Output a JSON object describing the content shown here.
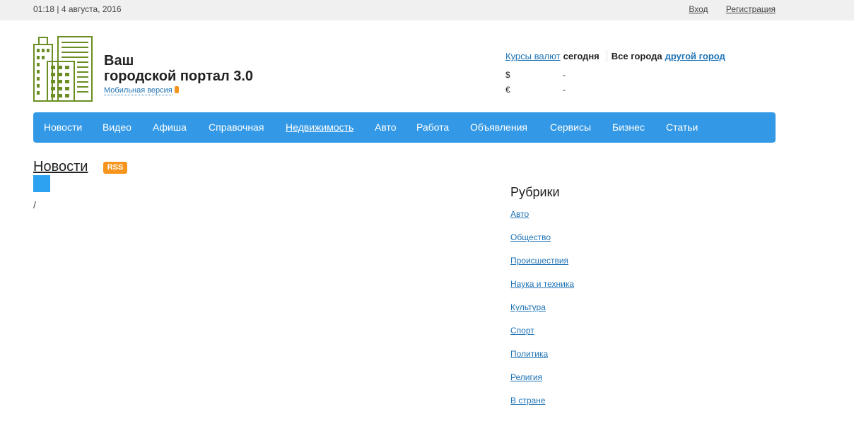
{
  "topbar": {
    "datetime": "01:18 | 4 августа, 2016",
    "login": "Вход",
    "register": "Регистрация"
  },
  "brand": {
    "line1": "Ваш",
    "line2": "городской портал 3.0",
    "mobile": "Мобильная версия"
  },
  "rates": {
    "link": "Курсы валют",
    "today": "сегодня",
    "all_cities": "Все города",
    "other_city": "другой город",
    "usd_symbol": "$",
    "usd_value": "-",
    "eur_symbol": "€",
    "eur_value": "-"
  },
  "nav": {
    "items": [
      "Новости",
      "Видео",
      "Афиша",
      "Справочная",
      "Недвижимость",
      "Авто",
      "Работа",
      "Объявления",
      "Сервисы",
      "Бизнес",
      "Статьи"
    ]
  },
  "news": {
    "title": "Новости",
    "rss": "RSS",
    "slash": "/"
  },
  "rubrics": {
    "title": "Рубрики",
    "items": [
      "Авто",
      "Общество",
      "Происшествия",
      "Наука и техника",
      "Культура",
      "Спорт",
      "Политика",
      "Религия",
      "В стране"
    ]
  }
}
